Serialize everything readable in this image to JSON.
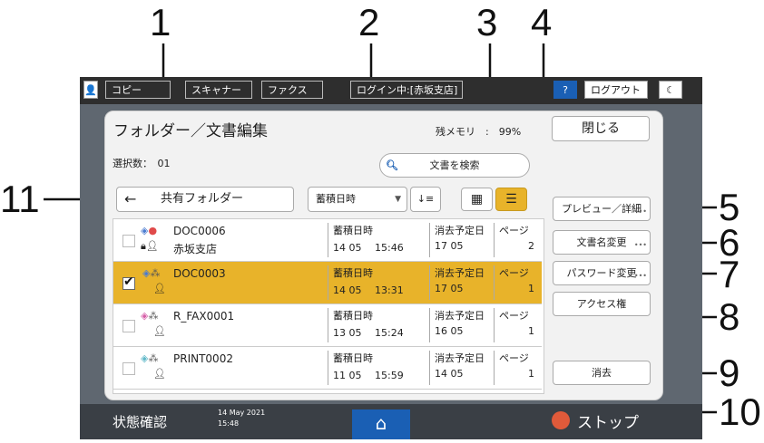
{
  "callouts": [
    "1",
    "2",
    "3",
    "4",
    "5",
    "6",
    "7",
    "8",
    "9",
    "10",
    "11"
  ],
  "topbar": {
    "copy": "コピー",
    "scanner": "スキャナー",
    "fax": "ファクス",
    "login": "ログイン中:[赤坂支店]",
    "help": "?",
    "logout": "ログアウト",
    "moon": "☾"
  },
  "panel": {
    "title": "フォルダー／文書編集",
    "memory": "残メモリ　:　99%",
    "close": "閉じる",
    "selected": "選択数：　01",
    "search": "文書を検索",
    "back_arrow": "←",
    "folder": "共有フォルダー",
    "sort": "蓄積日時",
    "sort_order": "↓≡"
  },
  "table": {
    "rows": [
      {
        "name": "DOC0006",
        "owner": "赤坂支店",
        "stored_h": "蓄積日時",
        "stored": "14 05　 15:46",
        "del_h": "消去予定日",
        "del": "17 05",
        "pages_h": "ページ",
        "pages": "2",
        "selected": false
      },
      {
        "name": "DOC0003",
        "owner": "",
        "stored_h": "蓄積日時",
        "stored": "14 05　 13:31",
        "del_h": "消去予定日",
        "del": "17 05",
        "pages_h": "ページ",
        "pages": "1",
        "selected": true
      },
      {
        "name": "R_FAX0001",
        "owner": "",
        "stored_h": "蓄積日時",
        "stored": "13 05　 15:24",
        "del_h": "消去予定日",
        "del": "16 05",
        "pages_h": "ページ",
        "pages": "1",
        "selected": false
      },
      {
        "name": "PRINT0002",
        "owner": "",
        "stored_h": "蓄積日時",
        "stored": "11 05　 15:59",
        "del_h": "消去予定日",
        "del": "14 05",
        "pages_h": "ページ",
        "pages": "1",
        "selected": false
      }
    ]
  },
  "right_buttons": {
    "preview": "プレビュー／詳細",
    "rename": "文書名変更",
    "password": "パスワード変更",
    "access": "アクセス権",
    "delete": "消去"
  },
  "bottom": {
    "status": "状態確認",
    "date": "14 May 2021",
    "time": "15:48",
    "home": "⌂",
    "stop": "ストップ"
  },
  "colors": {
    "selected_row": "#e8b32a",
    "accent_blue": "#1a5fb4",
    "dark_bar": "#2e2e2e"
  }
}
